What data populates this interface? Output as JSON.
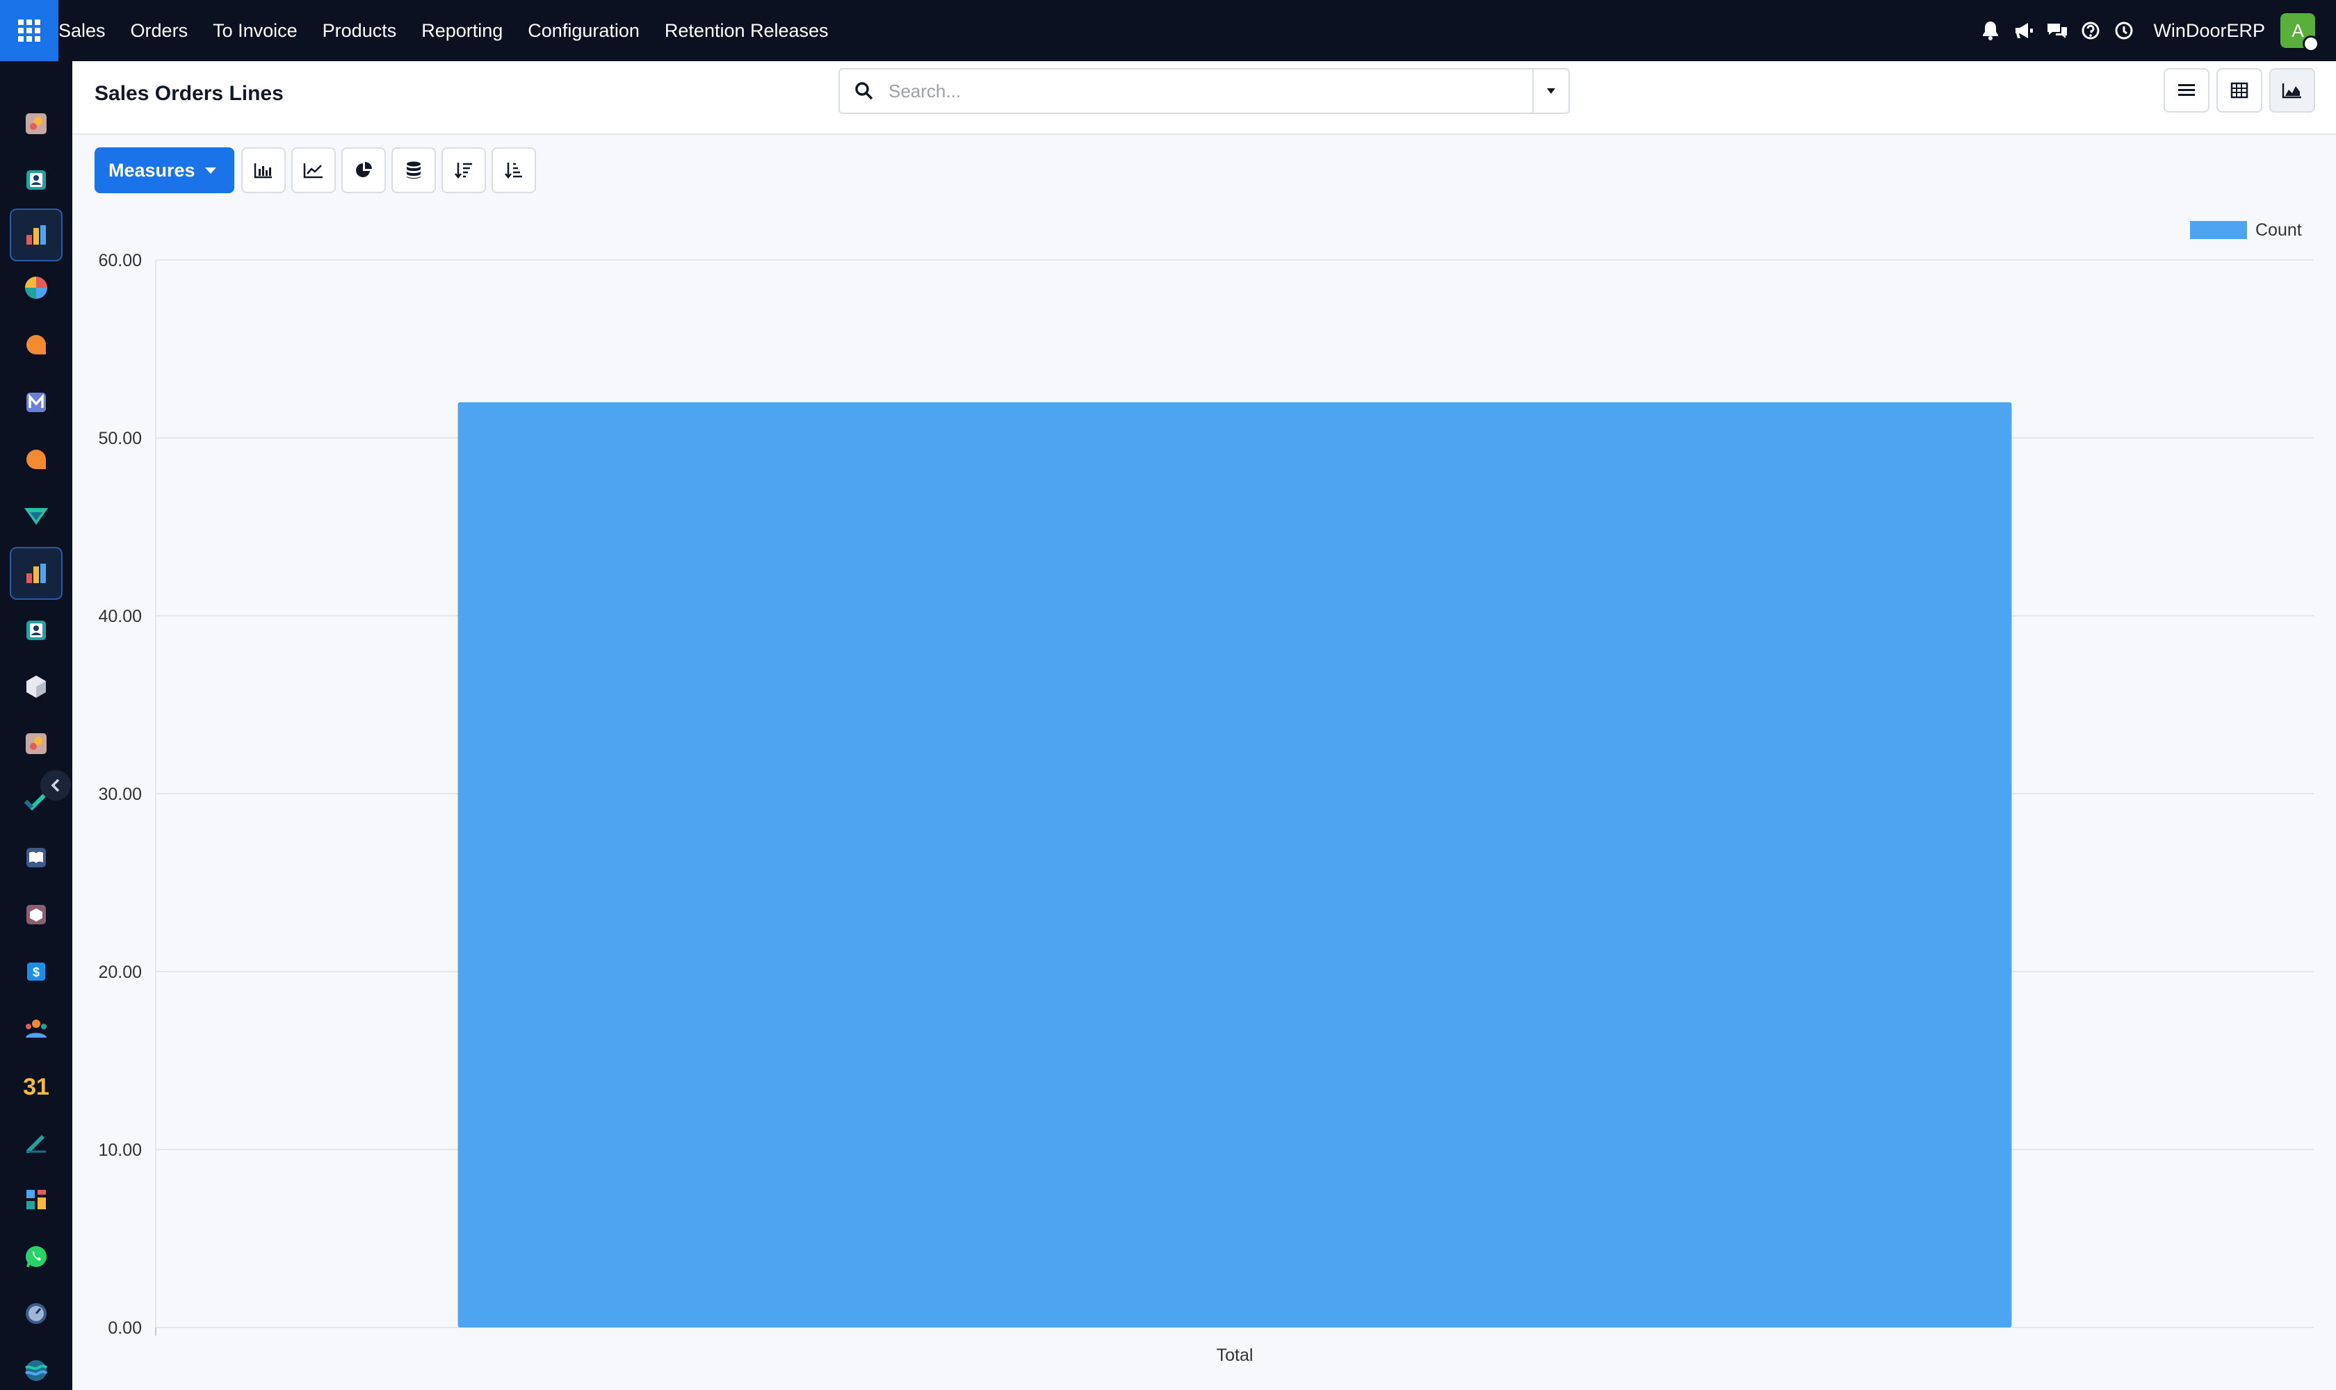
{
  "navbar": {
    "menu": [
      "Sales",
      "Orders",
      "To Invoice",
      "Products",
      "Reporting",
      "Configuration",
      "Retention Releases"
    ],
    "company": "WinDoorERP",
    "avatar_initial": "A",
    "icons": [
      "bell-icon",
      "megaphone-icon",
      "chat-icon",
      "help-icon",
      "clock-icon"
    ]
  },
  "sidebar": {
    "apps": [
      "app-a",
      "contacts",
      "dashboards",
      "pie-app",
      "discuss",
      "mail-marketing",
      "livechat",
      "v-app",
      "reporting",
      "contacts-2",
      "cube-app",
      "app-b",
      "check-app",
      "knowledge",
      "inventory",
      "invoicing",
      "employees",
      "calendar",
      "sign",
      "widgets",
      "whatsapp",
      "timer",
      "wave-app"
    ],
    "active": [
      2,
      8
    ],
    "calendar_label": "31"
  },
  "control_panel": {
    "title": "Sales Orders Lines",
    "search_placeholder": "Search..."
  },
  "toolbar": {
    "measures_label": "Measures"
  },
  "colors": {
    "bar": "#4da5f2",
    "primary": "#1a73e8",
    "navbar": "#0b1120"
  },
  "chart_data": {
    "type": "bar",
    "categories": [
      "Total"
    ],
    "series": [
      {
        "name": "Count",
        "values": [
          52
        ]
      }
    ],
    "ylim": [
      0,
      60
    ],
    "yticks": [
      "0.00",
      "10.00",
      "20.00",
      "30.00",
      "40.00",
      "50.00",
      "60.00"
    ],
    "grid": true,
    "legend": "top-right"
  }
}
